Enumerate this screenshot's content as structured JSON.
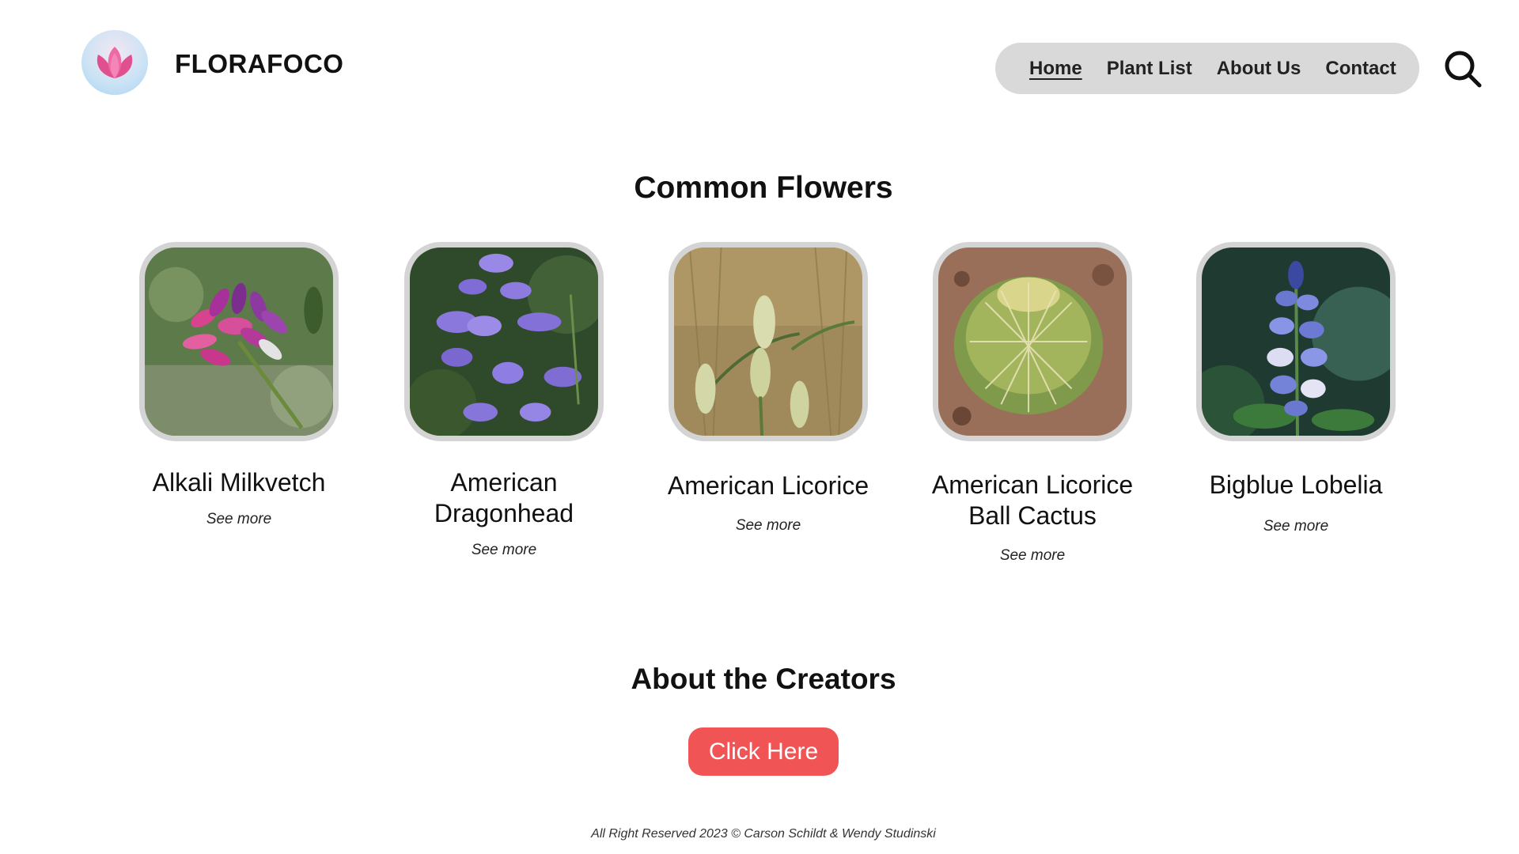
{
  "header": {
    "brand": "FLORAFOCO",
    "logo_icon": "lotus-icon",
    "nav": [
      {
        "label": "Home",
        "active": true
      },
      {
        "label": "Plant List",
        "active": false
      },
      {
        "label": "About Us",
        "active": false
      },
      {
        "label": "Contact",
        "active": false
      }
    ],
    "search_icon": "search-icon"
  },
  "flowers": {
    "title": "Common Flowers",
    "items": [
      {
        "name": "Alkali Milkvetch",
        "link": "See more"
      },
      {
        "name": "American Dragonhead",
        "link": "See more"
      },
      {
        "name": "American Licorice",
        "link": "See more"
      },
      {
        "name": "American Licorice Ball Cactus",
        "link": "See more"
      },
      {
        "name": "Bigblue Lobelia",
        "link": "See more"
      }
    ]
  },
  "creators": {
    "title": "About the Creators",
    "button": "Click Here"
  },
  "footer": {
    "text": "All Right Reserved 2023  © Carson Schildt & Wendy Studinski"
  },
  "colors": {
    "nav_bg": "#d9d9d9",
    "cta_bg": "#f05454",
    "card_border": "#d4d4d4"
  }
}
